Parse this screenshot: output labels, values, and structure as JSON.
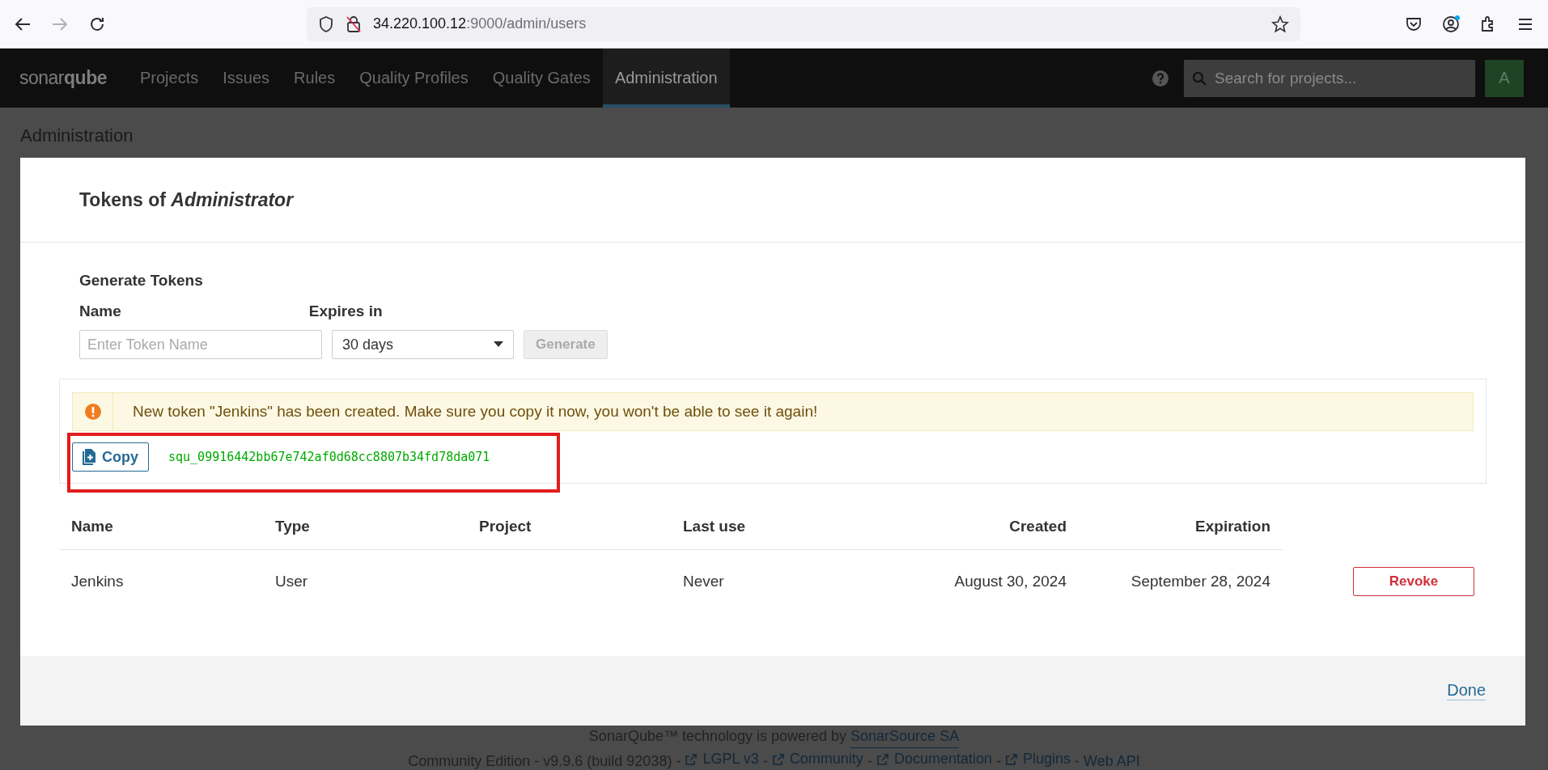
{
  "browser": {
    "url_host": "34.220.100.12",
    "url_path": ":9000/admin/users",
    "forward_disabled": true
  },
  "nav": {
    "logo": "sonar**qube**",
    "items": [
      {
        "label": "Projects",
        "selected": false
      },
      {
        "label": "Issues",
        "selected": false
      },
      {
        "label": "Rules",
        "selected": false
      },
      {
        "label": "Quality Profiles",
        "selected": false
      },
      {
        "label": "Quality Gates",
        "selected": false
      },
      {
        "label": "Administration",
        "selected": true
      }
    ],
    "search": {
      "placeholder": "Search for projects..."
    },
    "avatar": "A"
  },
  "page_title": "Administration",
  "modal": {
    "title": "Tokens of *Administrator*",
    "section": "Generate Tokens",
    "name_label": "Name",
    "name_placeholder": "Enter Token Name",
    "expires_label": "Expires in",
    "expires_value": "30 days",
    "generate": {
      "label": "Generate",
      "disabled": true
    },
    "alert": "New token \"Jenkins\" has been created. Make sure you copy it now, you won't be able to see it again!",
    "copy_label": "Copy",
    "token": "squ_09916442bb67e742af0d68cc8807b34fd78da071",
    "columns": [
      "Name",
      "Type",
      "Project",
      "Last use",
      "Created",
      "Expiration"
    ],
    "rows": [
      {
        "name": "Jenkins",
        "type": "User",
        "last_use": "Never",
        "created": "August 30, 2024",
        "expiration": "September 28, 2024",
        "action": "Revoke"
      }
    ],
    "done": "Done"
  },
  "footer": {
    "separator": "-",
    "line1_text": "SonarQube™ technology is powered by ",
    "line1_link": "SonarSource SA",
    "edition": "Community Edition",
    "version": "v9.9.6 (build 92038)",
    "links": [
      {
        "label": "LGPL v3",
        "external": true
      },
      {
        "label": "Community",
        "external": true
      },
      {
        "label": "Documentation",
        "external": true
      },
      {
        "label": "Plugins",
        "external": true
      },
      {
        "label": "Web API",
        "external": false
      }
    ]
  }
}
